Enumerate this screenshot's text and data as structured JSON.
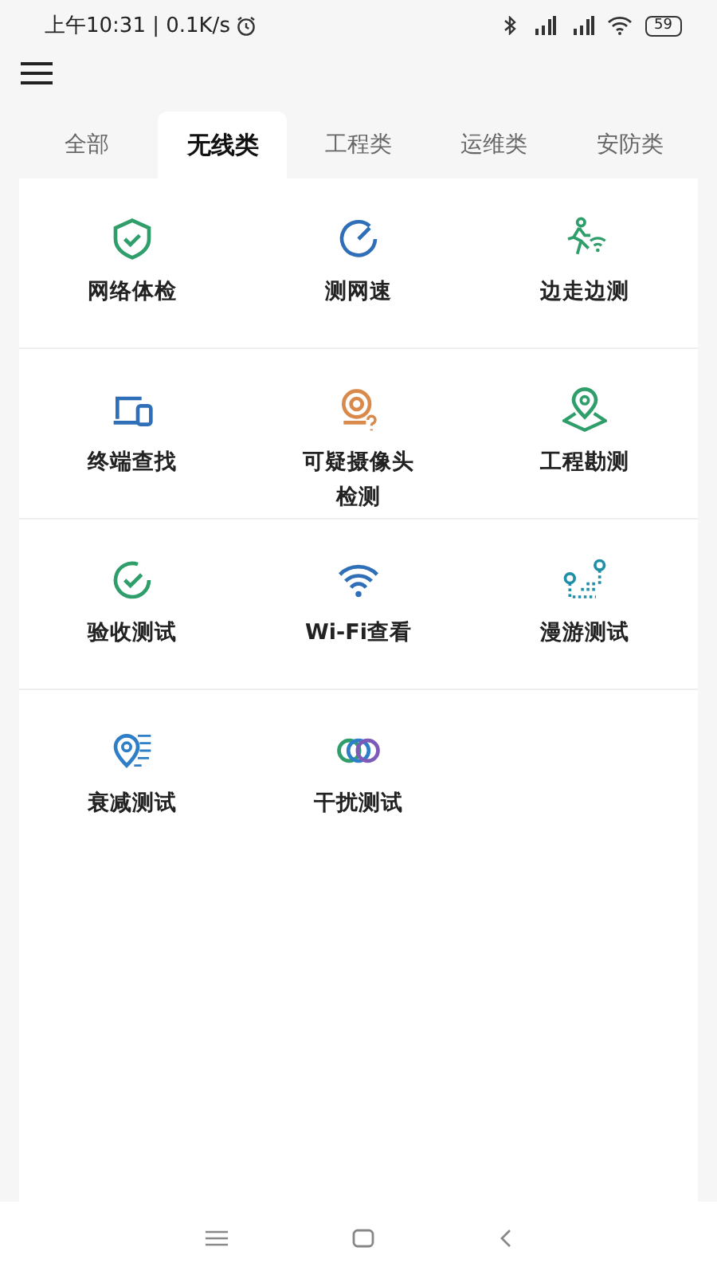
{
  "status_bar": {
    "time": "上午10:31 | 0.1K/s",
    "battery": "59"
  },
  "tabs": [
    {
      "label": "全部",
      "selected": false
    },
    {
      "label": "无线类",
      "selected": true
    },
    {
      "label": "工程类",
      "selected": false
    },
    {
      "label": "运维类",
      "selected": false
    },
    {
      "label": "安防类",
      "selected": false
    }
  ],
  "tools": [
    {
      "label": "网络体检"
    },
    {
      "label": "测网速"
    },
    {
      "label": "边走边测"
    },
    {
      "label": "终端查找"
    },
    {
      "label": "可疑摄像头检测"
    },
    {
      "label": "工程勘测"
    },
    {
      "label": "验收测试"
    },
    {
      "label": "Wi-Fi查看"
    },
    {
      "label": "漫游测试"
    },
    {
      "label": "衰减测试"
    },
    {
      "label": "干扰测试"
    }
  ]
}
